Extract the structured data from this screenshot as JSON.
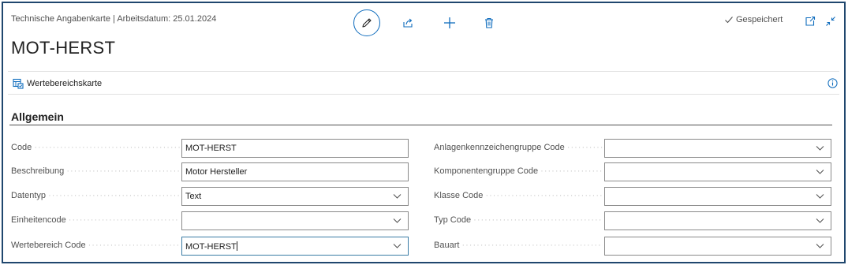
{
  "header": {
    "breadcrumb": "Technische Angabenkarte | Arbeitsdatum: 25.01.2024",
    "title": "MOT-HERST",
    "status": "Gespeichert",
    "icons": [
      "edit-icon",
      "share-icon",
      "new-icon",
      "delete-icon",
      "checkmark-icon",
      "open-new-window-icon",
      "collapse-icon"
    ]
  },
  "actions": {
    "wertebereichskarte": "Wertebereichskarte"
  },
  "section": {
    "title": "Allgemein"
  },
  "left_fields": [
    {
      "label": "Code",
      "value": "MOT-HERST",
      "type": "text"
    },
    {
      "label": "Beschreibung",
      "value": "Motor Hersteller",
      "type": "text"
    },
    {
      "label": "Datentyp",
      "value": "Text",
      "type": "select"
    },
    {
      "label": "Einheitencode",
      "value": "",
      "type": "select"
    },
    {
      "label": "Wertebereich Code",
      "value": "MOT-HERST",
      "type": "select",
      "focused": true
    }
  ],
  "right_fields": [
    {
      "label": "Anlagenkennzeichengruppe Code",
      "value": "",
      "type": "select"
    },
    {
      "label": "Komponentengruppe Code",
      "value": "",
      "type": "select"
    },
    {
      "label": "Klasse Code",
      "value": "",
      "type": "select"
    },
    {
      "label": "Typ Code",
      "value": "",
      "type": "select"
    },
    {
      "label": "Bauart",
      "value": "",
      "type": "select"
    }
  ],
  "colors": {
    "frame": "#20476e",
    "accent": "#0f6cbd",
    "focus": "#3a7ca5",
    "label": "#505050"
  }
}
